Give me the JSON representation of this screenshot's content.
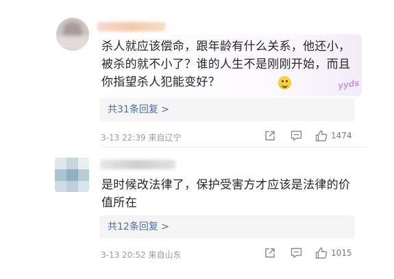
{
  "comments": [
    {
      "text": "杀人就应该偿命，跟年龄有什么关系，他还小，被杀的就不小了？谁的人生不是刚刚开始，而且你指望杀人犯能变好？",
      "sticker": "yyds",
      "replies_label": "共31条回复 >",
      "meta": "3-13 22:39  来自辽宁",
      "likes": "1474"
    },
    {
      "text": "是时候改法律了，保护受害方才应该是法律的价值所在",
      "replies_label": "共12条回复 >",
      "meta": "3-13 20:52  来自山东",
      "likes": "1015"
    }
  ],
  "icons": {
    "share": "share-icon",
    "comment": "comment-icon",
    "like": "thumbs-up-icon"
  },
  "colors": {
    "link": "#4a6fa5",
    "meta": "#9a9a9a",
    "reply_bg": "#f5f5f5"
  }
}
